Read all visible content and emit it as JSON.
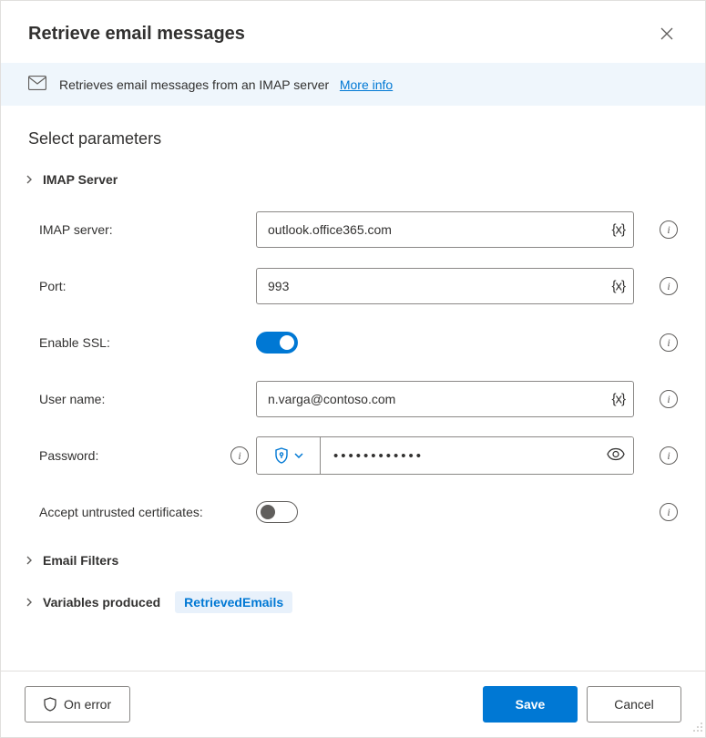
{
  "dialog": {
    "title": "Retrieve email messages",
    "banner": {
      "text": "Retrieves email messages from an IMAP server",
      "link": "More info"
    }
  },
  "section": {
    "title": "Select parameters",
    "group_imap": "IMAP Server",
    "group_filters": "Email Filters",
    "group_vars": "Variables produced",
    "var_badge": "RetrievedEmails"
  },
  "fields": {
    "imap_server": {
      "label": "IMAP server:",
      "value": "outlook.office365.com"
    },
    "port": {
      "label": "Port:",
      "value": "993"
    },
    "enable_ssl": {
      "label": "Enable SSL:",
      "value": true
    },
    "user_name": {
      "label": "User name:",
      "value": "n.varga@contoso.com"
    },
    "password": {
      "label": "Password:",
      "value": "••••••••••••"
    },
    "accept_untrusted": {
      "label": "Accept untrusted certificates:",
      "value": false
    }
  },
  "var_token": "{x}",
  "footer": {
    "on_error": "On error",
    "save": "Save",
    "cancel": "Cancel"
  }
}
